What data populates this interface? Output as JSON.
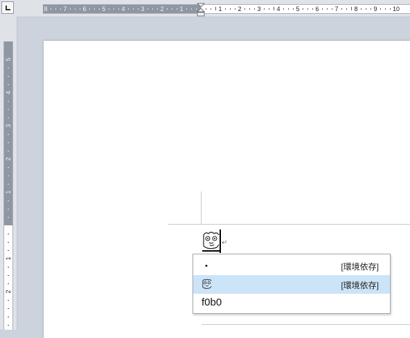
{
  "horizontal_ruler": {
    "left_numbers": [
      "8",
      "7",
      "6",
      "5",
      "4",
      "3",
      "2",
      "1"
    ],
    "right_numbers": [
      "1",
      "2",
      "3",
      "4",
      "5",
      "6",
      "7",
      "8",
      "9",
      "10"
    ]
  },
  "vertical_ruler": {
    "numbers": [
      "5",
      "4",
      "3",
      "2",
      "1",
      "1",
      "2"
    ]
  },
  "document": {
    "glyph_icon": "face-glyph-icon"
  },
  "ime_candidates": [
    {
      "label": "・",
      "note": "[環境依存]"
    },
    {
      "label": "",
      "icon": "face-glyph-icon",
      "note": "[環境依存]",
      "selected": true
    },
    {
      "label": "f0b0",
      "note": ""
    }
  ],
  "colors": {
    "workspace": "#cdd3dc",
    "ruler_margin": "#8f97a3",
    "candidate_highlight": "#cce4f7"
  }
}
